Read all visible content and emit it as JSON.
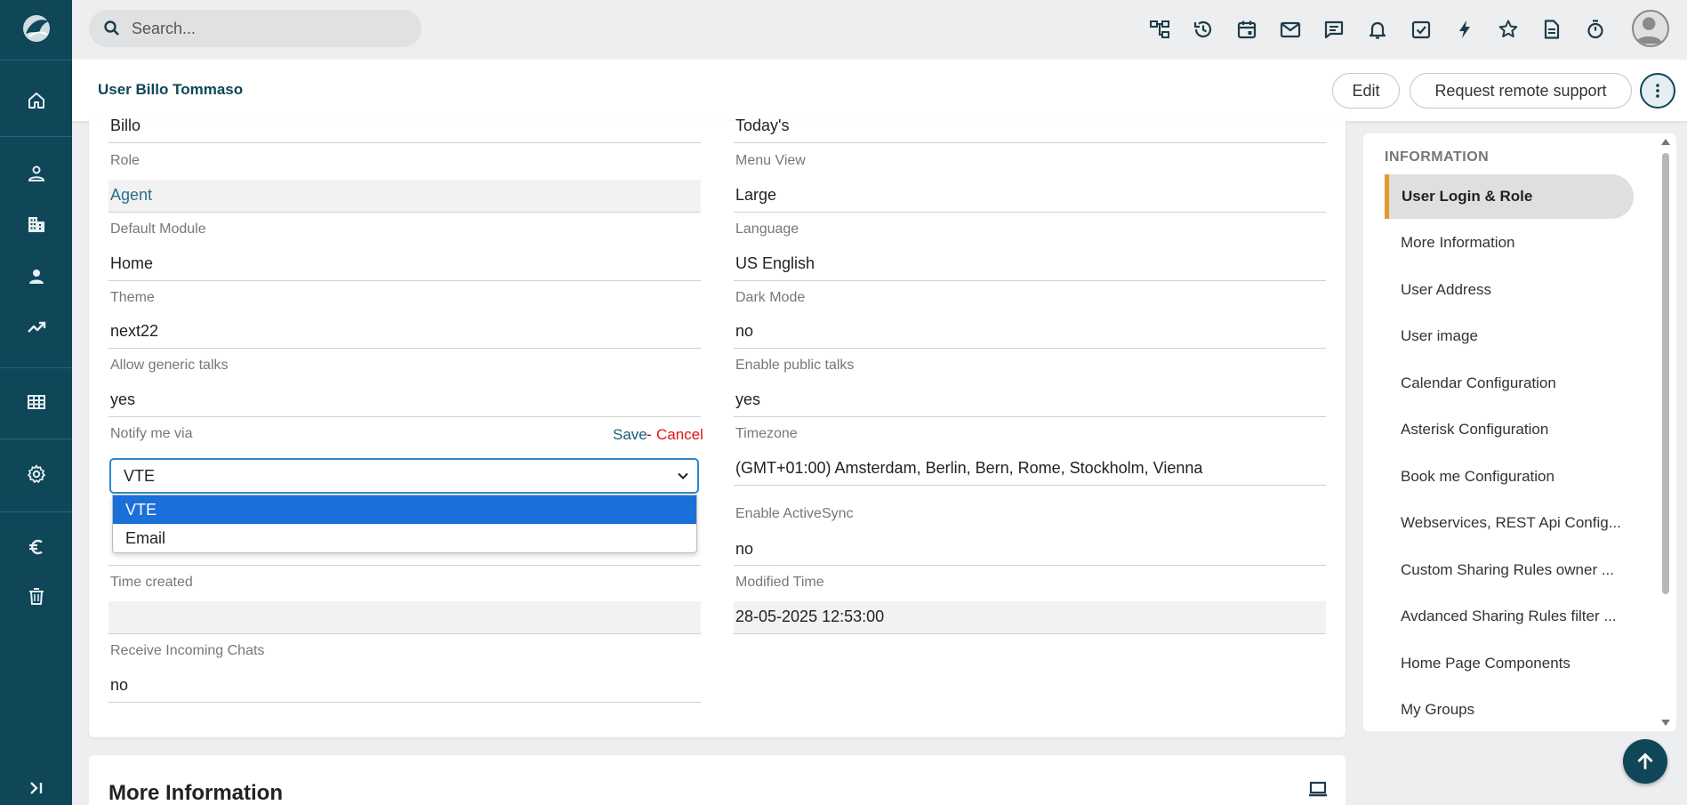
{
  "app": {
    "search_placeholder": "Search...",
    "page_title": "User Billo Tommaso"
  },
  "sidebar": {
    "items": [
      {
        "icon": "home-icon"
      },
      {
        "icon": "contacts-icon"
      },
      {
        "icon": "building-icon"
      },
      {
        "icon": "person-icon"
      },
      {
        "icon": "trending-icon"
      },
      {
        "icon": "grid-icon"
      },
      {
        "icon": "settings-icon"
      },
      {
        "icon": "euro-icon"
      },
      {
        "icon": "trash-icon"
      },
      {
        "icon": "expand-icon"
      }
    ]
  },
  "topbar_icons": [
    "hierarchy-icon",
    "history-icon",
    "calendar-icon",
    "mail-icon",
    "chat-icon",
    "bell-icon",
    "task-icon",
    "bolt-icon",
    "star-icon",
    "document-icon",
    "timer-icon"
  ],
  "header": {
    "edit_label": "Edit",
    "remote_label": "Request remote support"
  },
  "form": {
    "first_name_value": "Billo",
    "role_label": "Role",
    "role_value": "Agent",
    "default_module_label": "Default Module",
    "default_module_value": "Home",
    "theme_label": "Theme",
    "theme_value": "next22",
    "allow_generic_talks_label": "Allow generic talks",
    "allow_generic_talks_value": "yes",
    "notify_label": "Notify me via",
    "save_label": "Save",
    "dash": "-",
    "cancel_label": "Cancel",
    "notify_selected": "VTE",
    "notify_options": [
      "VTE",
      "Email"
    ],
    "time_created_label": "Time created",
    "time_created_value": "",
    "receive_chats_label": "Receive Incoming Chats",
    "receive_chats_value": "no",
    "right_top_value": "Today's",
    "menu_view_label": "Menu View",
    "menu_view_value": "Large",
    "language_label": "Language",
    "language_value": "US English",
    "dark_mode_label": "Dark Mode",
    "dark_mode_value": "no",
    "public_talks_label": "Enable public talks",
    "public_talks_value": "yes",
    "timezone_label": "Timezone",
    "timezone_value": "(GMT+01:00) Amsterdam, Berlin, Bern, Rome, Stockholm, Vienna",
    "activesync_label": "Enable ActiveSync",
    "activesync_value": "no",
    "modified_label": "Modified Time",
    "modified_value": "28-05-2025 12:53:00"
  },
  "more_info": {
    "title": "More Information"
  },
  "right_panel": {
    "heading": "INFORMATION",
    "items": [
      "User Login & Role",
      "More Information",
      "User Address",
      "User image",
      "Calendar Configuration",
      "Asterisk Configuration",
      "Book me Configuration",
      "Webservices, REST Api Config...",
      "Custom Sharing Rules owner ...",
      "Avdanced Sharing Rules filter ...",
      "Home Page Components",
      "My Groups"
    ]
  },
  "colors": {
    "sidebar": "#0f4658",
    "accent": "#e89a25",
    "select_blue": "#1a6fd9",
    "cancel_red": "#e01515"
  }
}
